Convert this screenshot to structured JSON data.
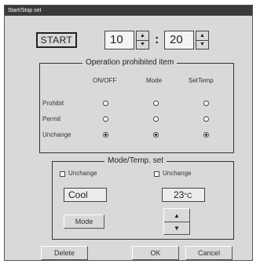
{
  "window": {
    "title": "Start/Stop set"
  },
  "timer": {
    "start_label": "START",
    "hour": "10",
    "minute": "20",
    "separator": ":"
  },
  "operation": {
    "title": "Operation prohibited item",
    "columns": [
      "ON/OFF",
      "Mode",
      "SetTemp"
    ],
    "rows": [
      {
        "label": "Prohibit",
        "selected": [
          false,
          false,
          false
        ]
      },
      {
        "label": "Permit",
        "selected": [
          false,
          false,
          false
        ]
      },
      {
        "label": "Unchange",
        "selected": [
          true,
          true,
          true
        ]
      }
    ]
  },
  "mode_temp": {
    "title": "Mode/Temp. set",
    "mode_unchange_label": "Unchange",
    "temp_unchange_label": "Unchange",
    "mode_value": "Cool",
    "temp_value": "23",
    "temp_unit": "°C",
    "mode_button": "Mode"
  },
  "footer": {
    "delete_label": "Delete",
    "ok_label": "OK",
    "cancel_label": "Cancel"
  },
  "icons": {
    "up": "▲",
    "down": "▼"
  }
}
